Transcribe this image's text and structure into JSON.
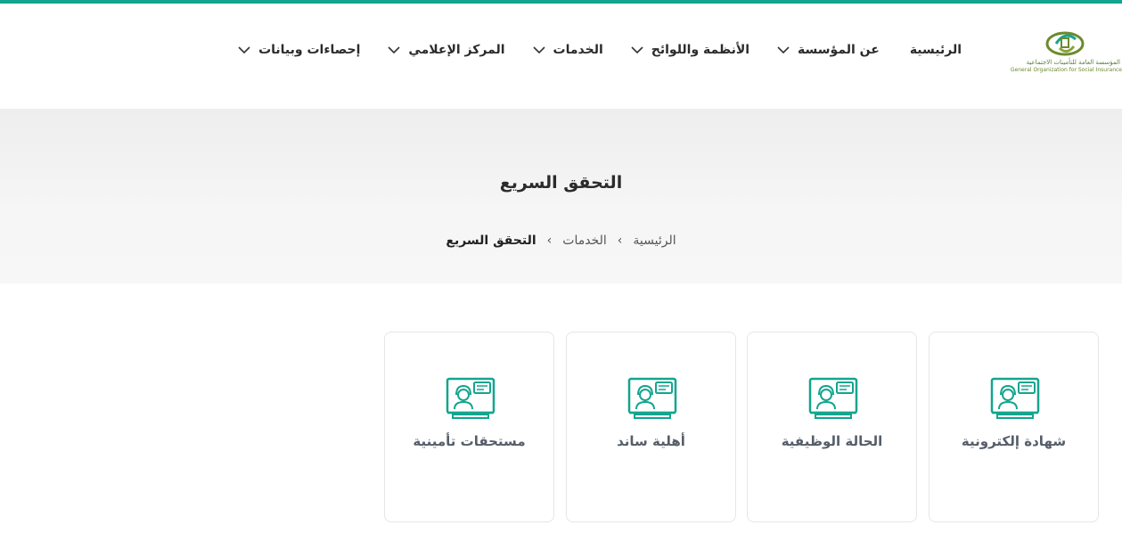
{
  "colors": {
    "accent": "#14a58e",
    "logo_green": "#6b8a2e"
  },
  "logo": {
    "arabic": "المؤسسة العامة للتأمينات الاجتماعية",
    "english": "General Organization for Social Insurance"
  },
  "nav": [
    {
      "label": "الرئيسية",
      "has_menu": false
    },
    {
      "label": "عن المؤسسة",
      "has_menu": true
    },
    {
      "label": "الأنظمة واللوائح",
      "has_menu": true
    },
    {
      "label": "الخدمات",
      "has_menu": true
    },
    {
      "label": "المركز الإعلامي",
      "has_menu": true
    },
    {
      "label": "إحصاءات وبيانات",
      "has_menu": true
    }
  ],
  "hero": {
    "title": "التحقق السريع"
  },
  "breadcrumb": [
    "الرئيسية",
    "الخدمات",
    "التحقق السريع"
  ],
  "cards": [
    {
      "label": "شهادة إلكترونية",
      "icon": "support-agent-laptop-icon"
    },
    {
      "label": "الحالة الوظيفية",
      "icon": "support-agent-laptop-icon"
    },
    {
      "label": "أهلية ساند",
      "icon": "support-agent-laptop-icon"
    },
    {
      "label": "مستحقات تأمينية",
      "icon": "support-agent-laptop-icon"
    }
  ]
}
